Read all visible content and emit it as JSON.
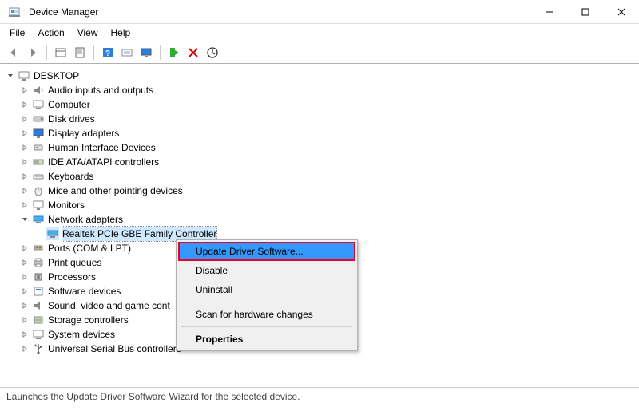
{
  "title": "Device Manager",
  "menubar": {
    "file": "File",
    "action": "Action",
    "view": "View",
    "help": "Help"
  },
  "tree": {
    "root": "DESKTOP",
    "nodes": [
      "Audio inputs and outputs",
      "Computer",
      "Disk drives",
      "Display adapters",
      "Human Interface Devices",
      "IDE ATA/ATAPI controllers",
      "Keyboards",
      "Mice and other pointing devices",
      "Monitors",
      "Network adapters",
      "Ports (COM & LPT)",
      "Print queues",
      "Processors",
      "Software devices",
      "Sound, video and game cont",
      "Storage controllers",
      "System devices",
      "Universal Serial Bus controllers"
    ],
    "selected_child": "Realtek PCIe GBE Family Controller"
  },
  "context_menu": {
    "update": "Update Driver Software...",
    "disable": "Disable",
    "uninstall": "Uninstall",
    "scan": "Scan for hardware changes",
    "properties": "Properties"
  },
  "statusbar": "Launches the Update Driver Software Wizard for the selected device."
}
